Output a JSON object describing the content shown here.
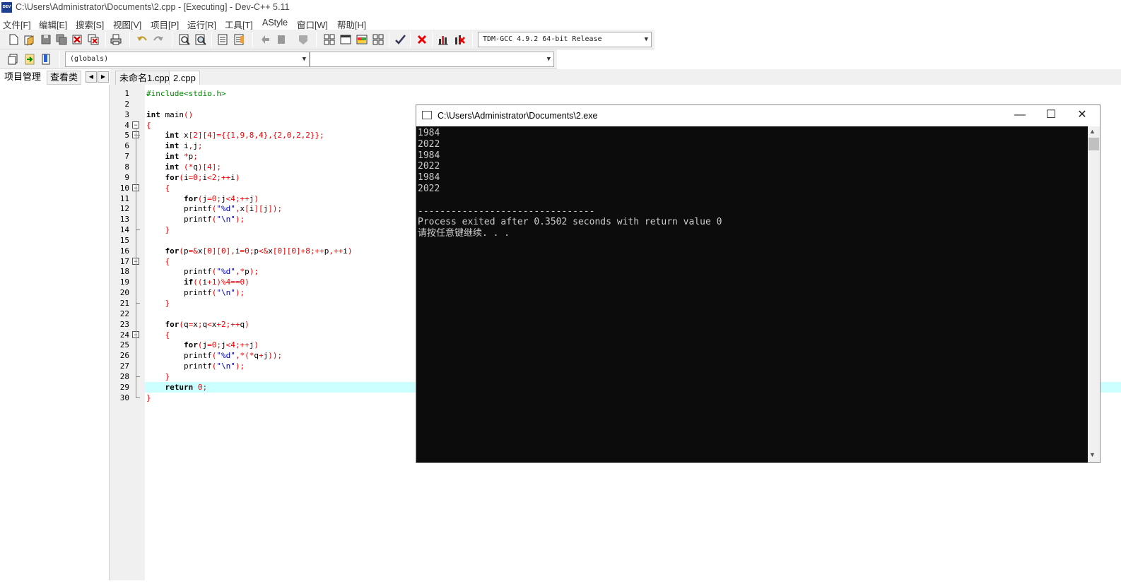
{
  "window": {
    "title": "C:\\Users\\Administrator\\Documents\\2.cpp - [Executing] - Dev-C++ 5.11",
    "icon_text": "DEV C++"
  },
  "menu": [
    "文件[F]",
    "编辑[E]",
    "搜索[S]",
    "视图[V]",
    "项目[P]",
    "运行[R]",
    "工具[T]",
    "AStyle",
    "窗口[W]",
    "帮助[H]"
  ],
  "toolbar": {
    "compiler_select": "TDM-GCC 4.9.2 64-bit Release",
    "scope_select": "(globals)",
    "symbol_select": ""
  },
  "sidebar": {
    "tabs": [
      "项目管理",
      "查看类"
    ]
  },
  "editor": {
    "tabs": [
      "未命名1.cpp",
      "2.cpp"
    ],
    "active_tab": "2.cpp",
    "current_line": 29,
    "line_numbers": [
      "1",
      "2",
      "3",
      "4",
      "5",
      "6",
      "7",
      "8",
      "9",
      "10",
      "11",
      "12",
      "13",
      "14",
      "15",
      "16",
      "17",
      "18",
      "19",
      "20",
      "21",
      "22",
      "23",
      "24",
      "25",
      "26",
      "27",
      "28",
      "29",
      "30"
    ]
  },
  "code": [
    [
      [
        "pp",
        "#include<stdio.h>"
      ]
    ],
    [],
    [
      [
        "kw",
        "int"
      ],
      [
        "n",
        " main"
      ],
      [
        "sym",
        "()"
      ]
    ],
    [
      [
        "sym",
        "{"
      ]
    ],
    [
      [
        "n",
        "    "
      ],
      [
        "kw",
        "int"
      ],
      [
        "n",
        " x"
      ],
      [
        "sym",
        "["
      ],
      [
        "num",
        "2"
      ],
      [
        "sym",
        "]["
      ],
      [
        "num",
        "4"
      ],
      [
        "sym",
        "]={{"
      ],
      [
        "num",
        "1"
      ],
      [
        "sym",
        ","
      ],
      [
        "num",
        "9"
      ],
      [
        "sym",
        ","
      ],
      [
        "num",
        "8"
      ],
      [
        "sym",
        ","
      ],
      [
        "num",
        "4"
      ],
      [
        "sym",
        "},{"
      ],
      [
        "num",
        "2"
      ],
      [
        "sym",
        ","
      ],
      [
        "num",
        "0"
      ],
      [
        "sym",
        ","
      ],
      [
        "num",
        "2"
      ],
      [
        "sym",
        ","
      ],
      [
        "num",
        "2"
      ],
      [
        "sym",
        "}};"
      ]
    ],
    [
      [
        "n",
        "    "
      ],
      [
        "kw",
        "int"
      ],
      [
        "n",
        " i"
      ],
      [
        "sym",
        ","
      ],
      [
        "n",
        "j"
      ],
      [
        "sym",
        ";"
      ]
    ],
    [
      [
        "n",
        "    "
      ],
      [
        "kw",
        "int"
      ],
      [
        "n",
        " "
      ],
      [
        "sym",
        "*"
      ],
      [
        "n",
        "p"
      ],
      [
        "sym",
        ";"
      ]
    ],
    [
      [
        "n",
        "    "
      ],
      [
        "kw",
        "int"
      ],
      [
        "n",
        " "
      ],
      [
        "sym",
        "(*"
      ],
      [
        "n",
        "q"
      ],
      [
        "sym",
        ")["
      ],
      [
        "num",
        "4"
      ],
      [
        "sym",
        "];"
      ]
    ],
    [
      [
        "n",
        "    "
      ],
      [
        "kw",
        "for"
      ],
      [
        "sym",
        "("
      ],
      [
        "n",
        "i"
      ],
      [
        "sym",
        "="
      ],
      [
        "num",
        "0"
      ],
      [
        "sym",
        ";"
      ],
      [
        "n",
        "i"
      ],
      [
        "sym",
        "<"
      ],
      [
        "num",
        "2"
      ],
      [
        "sym",
        ";++"
      ],
      [
        "n",
        "i"
      ],
      [
        "sym",
        ")"
      ]
    ],
    [
      [
        "n",
        "    "
      ],
      [
        "sym",
        "{"
      ]
    ],
    [
      [
        "n",
        "        "
      ],
      [
        "kw",
        "for"
      ],
      [
        "sym",
        "("
      ],
      [
        "n",
        "j"
      ],
      [
        "sym",
        "="
      ],
      [
        "num",
        "0"
      ],
      [
        "sym",
        ";"
      ],
      [
        "n",
        "j"
      ],
      [
        "sym",
        "<"
      ],
      [
        "num",
        "4"
      ],
      [
        "sym",
        ";++"
      ],
      [
        "n",
        "j"
      ],
      [
        "sym",
        ")"
      ]
    ],
    [
      [
        "n",
        "        printf"
      ],
      [
        "sym",
        "("
      ],
      [
        "str",
        "\"%d\""
      ],
      [
        "sym",
        ","
      ],
      [
        "n",
        "x"
      ],
      [
        "sym",
        "["
      ],
      [
        "n",
        "i"
      ],
      [
        "sym",
        "]["
      ],
      [
        "n",
        "j"
      ],
      [
        "sym",
        "]);"
      ]
    ],
    [
      [
        "n",
        "        printf"
      ],
      [
        "sym",
        "("
      ],
      [
        "str",
        "\"\\n\""
      ],
      [
        "sym",
        ");"
      ]
    ],
    [
      [
        "n",
        "    "
      ],
      [
        "sym",
        "}"
      ]
    ],
    [],
    [
      [
        "n",
        "    "
      ],
      [
        "kw",
        "for"
      ],
      [
        "sym",
        "("
      ],
      [
        "n",
        "p"
      ],
      [
        "sym",
        "=&"
      ],
      [
        "n",
        "x"
      ],
      [
        "sym",
        "["
      ],
      [
        "num",
        "0"
      ],
      [
        "sym",
        "]["
      ],
      [
        "num",
        "0"
      ],
      [
        "sym",
        "],"
      ],
      [
        "n",
        "i"
      ],
      [
        "sym",
        "="
      ],
      [
        "num",
        "0"
      ],
      [
        "sym",
        ";"
      ],
      [
        "n",
        "p"
      ],
      [
        "sym",
        "<&"
      ],
      [
        "n",
        "x"
      ],
      [
        "sym",
        "["
      ],
      [
        "num",
        "0"
      ],
      [
        "sym",
        "]["
      ],
      [
        "num",
        "0"
      ],
      [
        "sym",
        "]+"
      ],
      [
        "num",
        "8"
      ],
      [
        "sym",
        ";++"
      ],
      [
        "n",
        "p"
      ],
      [
        "sym",
        ",++"
      ],
      [
        "n",
        "i"
      ],
      [
        "sym",
        ")"
      ]
    ],
    [
      [
        "n",
        "    "
      ],
      [
        "sym",
        "{"
      ]
    ],
    [
      [
        "n",
        "        printf"
      ],
      [
        "sym",
        "("
      ],
      [
        "str",
        "\"%d\""
      ],
      [
        "sym",
        ",*"
      ],
      [
        "n",
        "p"
      ],
      [
        "sym",
        ");"
      ]
    ],
    [
      [
        "n",
        "        "
      ],
      [
        "kw",
        "if"
      ],
      [
        "sym",
        "(("
      ],
      [
        "n",
        "i"
      ],
      [
        "sym",
        "+"
      ],
      [
        "num",
        "1"
      ],
      [
        "sym",
        ")%"
      ],
      [
        "num",
        "4"
      ],
      [
        "sym",
        "=="
      ],
      [
        "num",
        "0"
      ],
      [
        "sym",
        ")"
      ]
    ],
    [
      [
        "n",
        "        printf"
      ],
      [
        "sym",
        "("
      ],
      [
        "str",
        "\"\\n\""
      ],
      [
        "sym",
        ");"
      ]
    ],
    [
      [
        "n",
        "    "
      ],
      [
        "sym",
        "}"
      ]
    ],
    [],
    [
      [
        "n",
        "    "
      ],
      [
        "kw",
        "for"
      ],
      [
        "sym",
        "("
      ],
      [
        "n",
        "q"
      ],
      [
        "sym",
        "="
      ],
      [
        "n",
        "x"
      ],
      [
        "sym",
        ";"
      ],
      [
        "n",
        "q"
      ],
      [
        "sym",
        "<"
      ],
      [
        "n",
        "x"
      ],
      [
        "sym",
        "+"
      ],
      [
        "num",
        "2"
      ],
      [
        "sym",
        ";++"
      ],
      [
        "n",
        "q"
      ],
      [
        "sym",
        ")"
      ]
    ],
    [
      [
        "n",
        "    "
      ],
      [
        "sym",
        "{"
      ]
    ],
    [
      [
        "n",
        "        "
      ],
      [
        "kw",
        "for"
      ],
      [
        "sym",
        "("
      ],
      [
        "n",
        "j"
      ],
      [
        "sym",
        "="
      ],
      [
        "num",
        "0"
      ],
      [
        "sym",
        ";"
      ],
      [
        "n",
        "j"
      ],
      [
        "sym",
        "<"
      ],
      [
        "num",
        "4"
      ],
      [
        "sym",
        ";++"
      ],
      [
        "n",
        "j"
      ],
      [
        "sym",
        ")"
      ]
    ],
    [
      [
        "n",
        "        printf"
      ],
      [
        "sym",
        "("
      ],
      [
        "str",
        "\"%d\""
      ],
      [
        "sym",
        ",*(*"
      ],
      [
        "n",
        "q"
      ],
      [
        "sym",
        "+"
      ],
      [
        "n",
        "j"
      ],
      [
        "sym",
        "));"
      ]
    ],
    [
      [
        "n",
        "        printf"
      ],
      [
        "sym",
        "("
      ],
      [
        "str",
        "\"\\n\""
      ],
      [
        "sym",
        ");"
      ]
    ],
    [
      [
        "n",
        "    "
      ],
      [
        "sym",
        "}"
      ]
    ],
    [
      [
        "n",
        "    "
      ],
      [
        "kw",
        "return"
      ],
      [
        "n",
        " "
      ],
      [
        "num",
        "0"
      ],
      [
        "sym",
        ";"
      ]
    ],
    [
      [
        "sym",
        "}"
      ]
    ]
  ],
  "console": {
    "title": "C:\\Users\\Administrator\\Documents\\2.exe",
    "lines": [
      "1984",
      "2022",
      "1984",
      "2022",
      "1984",
      "2022",
      "",
      "--------------------------------",
      "Process exited after 0.3502 seconds with return value 0",
      "请按任意键继续. . ."
    ],
    "minimize_glyph": "—",
    "maximize_glyph": "☐",
    "close_glyph": "✕"
  }
}
